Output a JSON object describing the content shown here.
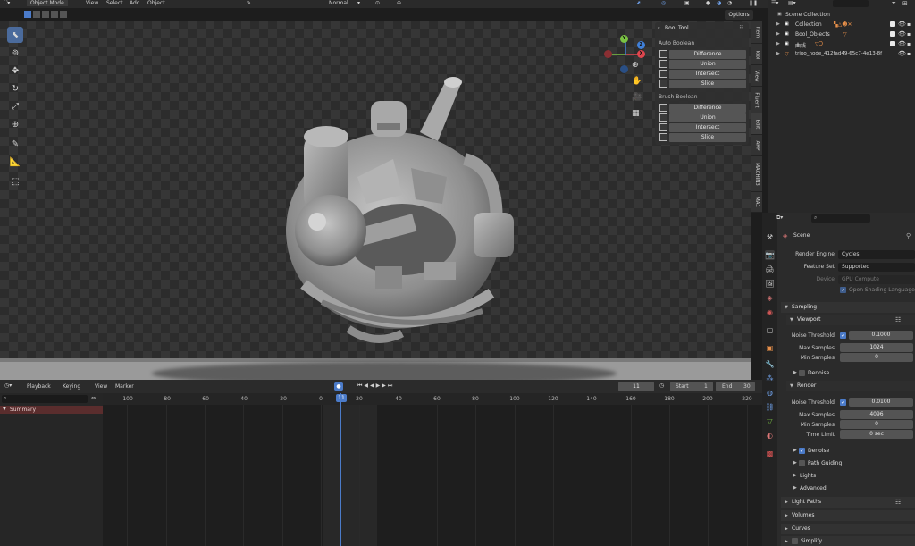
{
  "header": {
    "mode": "Object Mode",
    "menus": [
      "View",
      "Select",
      "Add",
      "Object"
    ],
    "orientation": "Normal",
    "options": "Options"
  },
  "ntabs": [
    "Item",
    "Tool",
    "View",
    "Fluent",
    "Edit",
    "ARP",
    "MACHIN3",
    "MA1"
  ],
  "bool_tool": {
    "title": "Bool Tool",
    "auto_label": "Auto Boolean",
    "auto": [
      "Difference",
      "Union",
      "Intersect",
      "Slice"
    ],
    "brush_label": "Brush Boolean",
    "brush": [
      "Difference",
      "Union",
      "Intersect",
      "Slice"
    ]
  },
  "gizmo": {
    "x": "X",
    "y": "Y",
    "z": "Z"
  },
  "timeline": {
    "menus": [
      "Playback",
      "Keying",
      "View",
      "Marker"
    ],
    "current_frame": "11",
    "start_label": "Start",
    "start": "1",
    "end_label": "End",
    "end": "30",
    "summary": "Summary",
    "ticks": [
      "-100",
      "-80",
      "-60",
      "-40",
      "-20",
      "0",
      "11",
      "20",
      "40",
      "60",
      "80",
      "100",
      "120",
      "140",
      "160",
      "180",
      "200",
      "220"
    ]
  },
  "outliner": {
    "root": "Scene Collection",
    "rows": [
      {
        "name": "Collection"
      },
      {
        "name": "Bool_Objects"
      },
      {
        "name": "曲线"
      },
      {
        "name": "tripo_node_412fad49-65c7-4e13-8f"
      }
    ]
  },
  "properties": {
    "scene_label": "Scene",
    "render_engine_label": "Render Engine",
    "render_engine": "Cycles",
    "feature_set_label": "Feature Set",
    "feature_set": "Supported",
    "device_label": "Device",
    "device": "GPU Compute",
    "osl_label": "Open Shading Language",
    "sampling": "Sampling",
    "viewport": "Viewport",
    "noise_threshold_label": "Noise Threshold",
    "vp_noise_threshold": "0.1000",
    "max_samples_label": "Max Samples",
    "vp_max_samples": "1024",
    "min_samples_label": "Min Samples",
    "vp_min_samples": "0",
    "denoise": "Denoise",
    "render": "Render",
    "r_noise_threshold": "0.0100",
    "r_max_samples": "4096",
    "r_min_samples": "0",
    "time_limit_label": "Time Limit",
    "r_time_limit": "0 sec",
    "path_guiding": "Path Guiding",
    "lights": "Lights",
    "advanced": "Advanced",
    "light_paths": "Light Paths",
    "volumes": "Volumes",
    "curves": "Curves",
    "simplify": "Simplify"
  },
  "colors": {
    "accent": "#4b7bc9",
    "x_axis": "#e0464e",
    "y_axis": "#7ac243",
    "z_axis": "#3f7fd8"
  }
}
